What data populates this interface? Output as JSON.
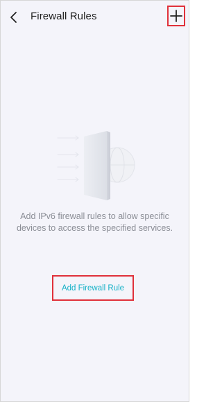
{
  "header": {
    "title": "Firewall Rules",
    "back_icon": "chevron-left-icon",
    "add_icon": "plus-icon"
  },
  "empty_state": {
    "illustration_icon": "firewall-globe-illustration",
    "description": "Add IPv6 firewall rules to allow specific devices to access the specified services.",
    "action_label": "Add Firewall Rule"
  },
  "colors": {
    "accent": "#14b1c7",
    "highlight": "#e0303a",
    "background": "#f4f4fa",
    "description_text": "#8b8e96"
  }
}
